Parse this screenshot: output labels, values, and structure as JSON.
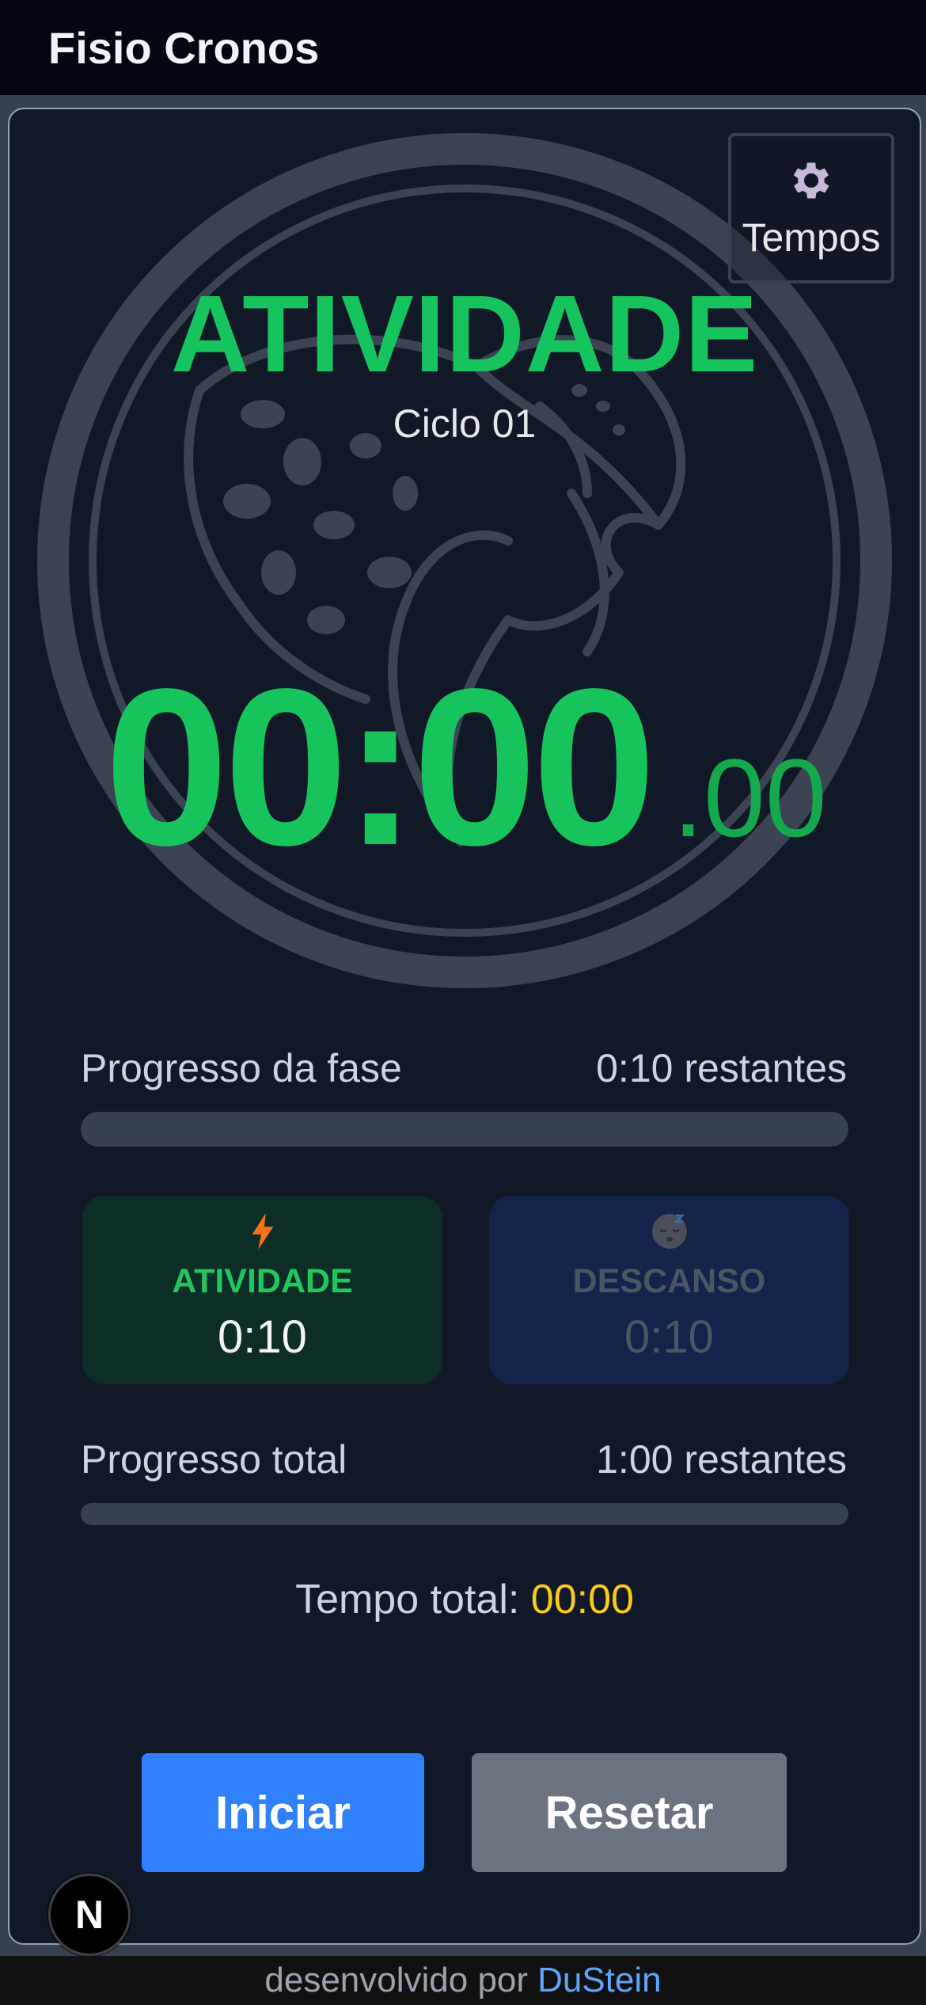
{
  "header": {
    "title": "Fisio Cronos"
  },
  "settings": {
    "label": "Tempos",
    "icon": "gear-icon"
  },
  "phase": {
    "title": "ATIVIDADE",
    "cycle": "Ciclo 01",
    "color": "#16c45d"
  },
  "timer": {
    "main": "00:00",
    "cent": ".00"
  },
  "phase_progress": {
    "label": "Progresso da fase",
    "remaining": "0:10 restantes",
    "fraction": 0
  },
  "phases": [
    {
      "icon": "lightning-icon",
      "name": "ATIVIDADE",
      "time": "0:10"
    },
    {
      "icon": "sleeping-face-icon",
      "name": "DESCANSO",
      "time": "0:10"
    }
  ],
  "total_progress": {
    "label": "Progresso total",
    "remaining": "1:00 restantes",
    "fraction": 0
  },
  "total_time": {
    "label": "Tempo total:",
    "value": "00:00"
  },
  "buttons": {
    "start": "Iniciar",
    "reset": "Resetar"
  },
  "badge": {
    "letter": "N"
  },
  "footer": {
    "prefix": "desenvolvido por",
    "author": "DuStein"
  },
  "colors": {
    "accent_green": "#16c45d",
    "primary_blue": "#2f80fa",
    "reset_gray": "#6b7280",
    "total_yellow": "#facc15",
    "link_blue": "#60a5fa"
  }
}
